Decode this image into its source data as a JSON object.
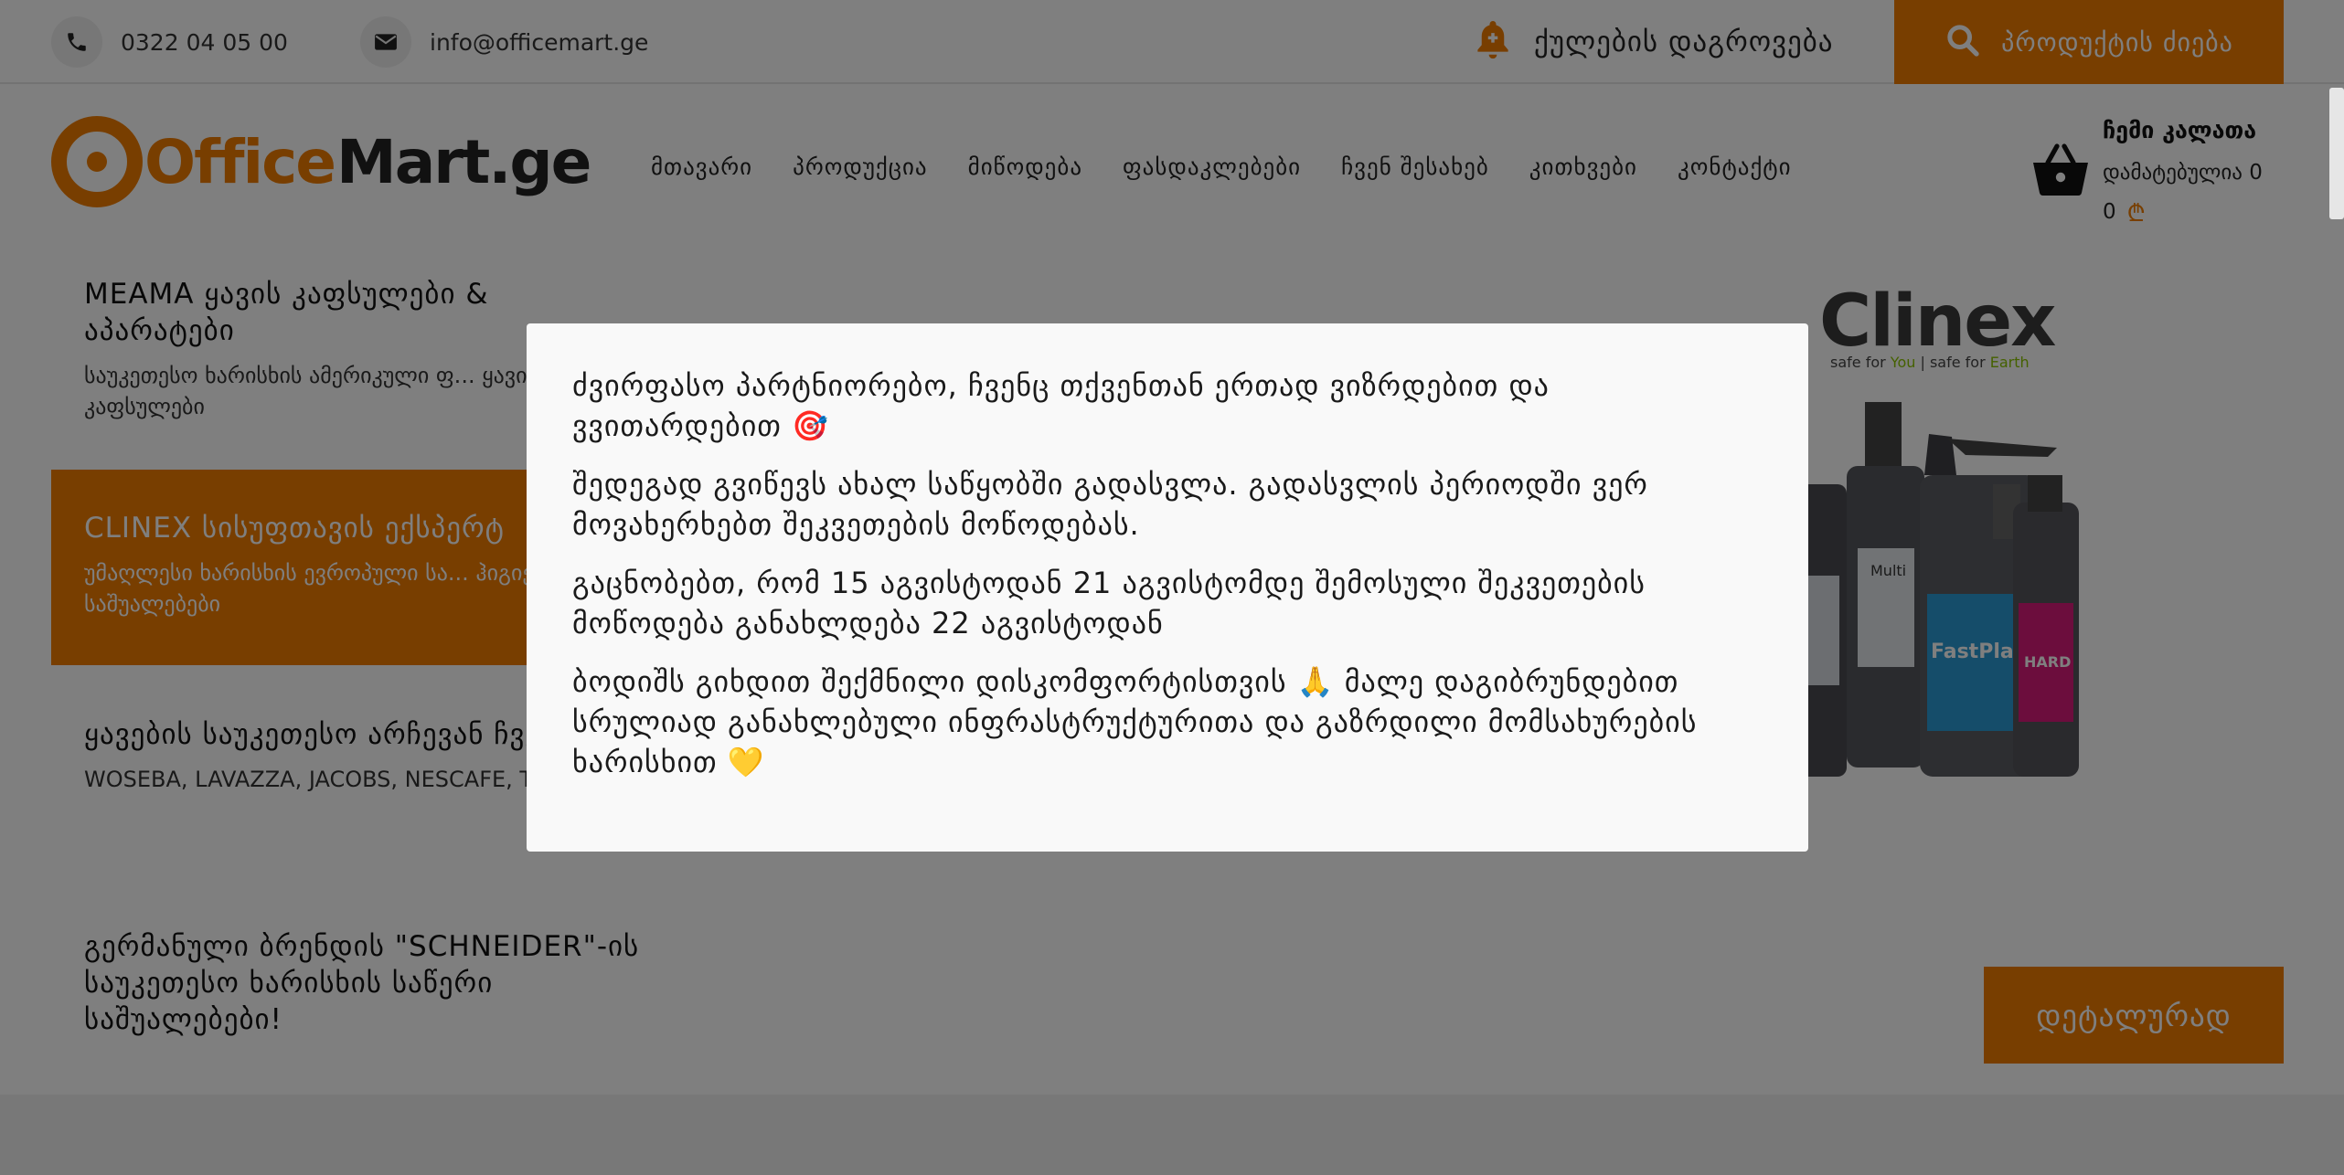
{
  "topbar": {
    "phone": "0322 04 05 00",
    "email": "info@officemart.ge",
    "points_label": "ქულების დაგროვება",
    "search_label": "პროდუქტის ძიება"
  },
  "logo": {
    "part1": "Office",
    "part2": "Mart.ge"
  },
  "nav": {
    "items": [
      "მთავარი",
      "პროდუქცია",
      "მიწოდება",
      "ფასდაკლებები",
      "ჩვენ შესახებ",
      "კითხვები",
      "კონტაქტი"
    ]
  },
  "cart": {
    "title": "ჩემი კალათა",
    "added_label": "დამატებულია 0",
    "total": "0",
    "currency": "₾"
  },
  "slides": [
    {
      "title": "MEAMA ყავის კაფსულები & აპარატები",
      "desc": "საუკეთესო ხარისხის ამერიკული ფ... ყავის კაფსულები"
    },
    {
      "title": "CLINEX სისუფთავის ექსპერტ",
      "desc": "უმაღლესი ხარისხის ევროპული სა... ჰიგიენური საშუალებები"
    },
    {
      "title": "ყავების საუკეთესო არჩევან ჩვენთან!",
      "desc": "WOSEBA, LAVAZZA, JACOBS, NESCAFE, T..."
    },
    {
      "title": "გერმანული ბრენდის \"SCHNEIDER\"-ის საუკეთესო ხარისხის საწერი საშუალებები!",
      "desc": ""
    }
  ],
  "promo": {
    "brand": "Clinex",
    "tagline_parts": [
      "safe for ",
      "You",
      " | safe for ",
      "Earth"
    ],
    "products": [
      "Multi",
      "FastPlast",
      "HARD"
    ]
  },
  "details_label": "დეტალურად",
  "modal": {
    "paragraphs": [
      "ძვირფასო პარტნიორებო, ჩვენც თქვენთან ერთად ვიზრდებით და ვვითარდებით 🎯",
      "შედეგად გვიწევს ახალ საწყობში გადასვლა. გადასვლის პერიოდში ვერ მოვახერხებთ შეკვეთების მოწოდებას.",
      "გაცნობებთ, რომ 15 აგვისტოდან 21 აგვისტომდე შემოსული შეკვეთების მოწოდება განახლდება 22 აგვისტოდან",
      "ბოდიშს გიხდით შექმნილი დისკომფორტისთვის 🙏 მალე დაგიბრუნდებით სრულიად განახლებული ინფრასტრუქტურითა და გაზრდილი მომსახურების ხარისხით 💛"
    ]
  },
  "colors": {
    "accent": "#f07d00",
    "overlay": "rgba(0,0,0,0.5)",
    "modal_bg": "#f9f9f9"
  }
}
